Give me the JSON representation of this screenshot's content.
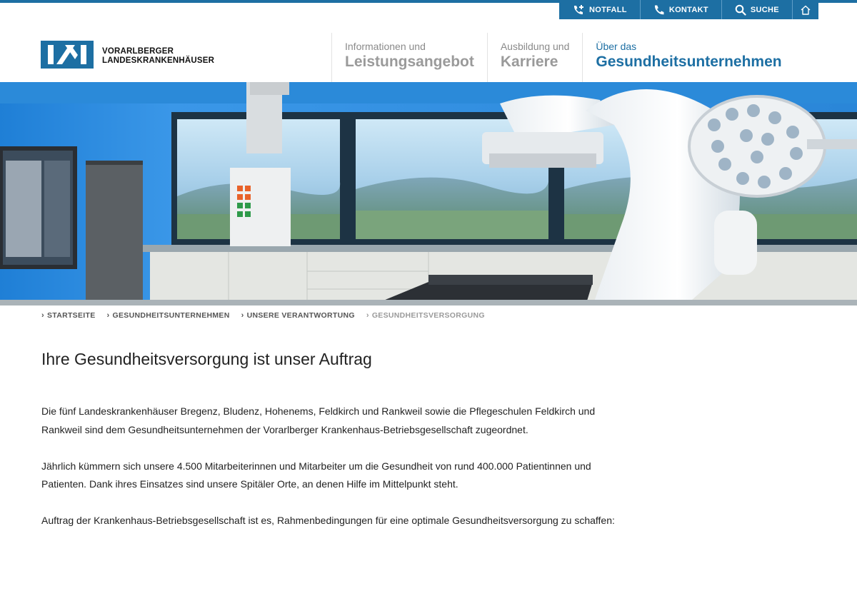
{
  "utility_nav": {
    "notfall": "NOTFALL",
    "kontakt": "KONTAKT",
    "suche": "SUCHE"
  },
  "logo": {
    "line1": "VORARLBERGER",
    "line2": "LANDESKRANKENHÄUSER"
  },
  "main_nav": [
    {
      "small": "Informationen und",
      "big": "Leistungsangebot"
    },
    {
      "small": "Ausbildung und",
      "big": "Karriere"
    },
    {
      "small": "Über das",
      "big": "Gesundheitsunternehmen"
    }
  ],
  "breadcrumb": [
    "STARTSEITE",
    "GESUNDHEITSUNTERNEHMEN",
    "UNSERE VERANTWORTUNG",
    "GESUNDHEITSVERSORGUNG"
  ],
  "page_title": "Ihre Gesundheitsversorgung ist unser Auftrag",
  "paragraphs": [
    "Die fünf Landeskrankenhäuser Bregenz, Bludenz, Hohenems, Feldkirch und Rankweil sowie die Pflegeschulen Feldkirch und Rankweil sind dem Gesundheitsunternehmen der Vorarlberger Krankenhaus-Betriebsgesellschaft zugeordnet.",
    "Jährlich kümmern sich unsere 4.500 Mitarbeiterinnen und Mitarbeiter um die Gesundheit von rund 400.000 Patientinnen und Patienten. Dank ihres Einsatzes sind unsere Spitäler Orte, an denen Hilfe im Mittelpunkt steht.",
    "Auftrag der Krankenhaus-Betriebsgesellschaft ist es, Rahmenbedingungen für eine optimale Gesundheitsversorgung  zu schaffen:"
  ],
  "colors": {
    "brand_blue": "#1d6fa3",
    "nav_gray": "#9a9a9a"
  }
}
